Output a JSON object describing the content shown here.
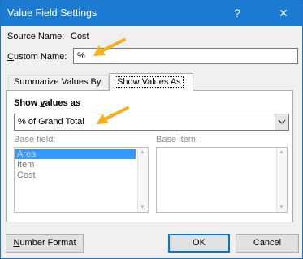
{
  "window": {
    "title": "Value Field Settings",
    "help_glyph": "?",
    "close_glyph": "✕"
  },
  "source": {
    "label": "Source Name:",
    "value": "Cost"
  },
  "custom_name": {
    "label_pre": "",
    "label_access": "C",
    "label_post": "ustom Name:",
    "value": "%"
  },
  "tabs": [
    {
      "label": "Summarize Values By",
      "active": false
    },
    {
      "label": "Show Values As",
      "active": true
    }
  ],
  "show_values": {
    "label_pre": "Show ",
    "label_access": "v",
    "label_post": "alues as",
    "selected": "% of Grand Total"
  },
  "base_field": {
    "label": "Base field:",
    "items": [
      "Area",
      "Item",
      "Cost"
    ],
    "selected_index": 0
  },
  "base_item": {
    "label": "Base item:"
  },
  "buttons": {
    "number_format_access": "N",
    "number_format_rest": "umber Format",
    "ok": "OK",
    "cancel": "Cancel"
  },
  "colors": {
    "titlebar": "#1b7ad1",
    "selection": "#3399ff",
    "annotation_arrow": "#f2b01e"
  },
  "icons": [
    "help-icon",
    "close-icon",
    "chevron-down-icon",
    "annotation-arrow-icon"
  ]
}
